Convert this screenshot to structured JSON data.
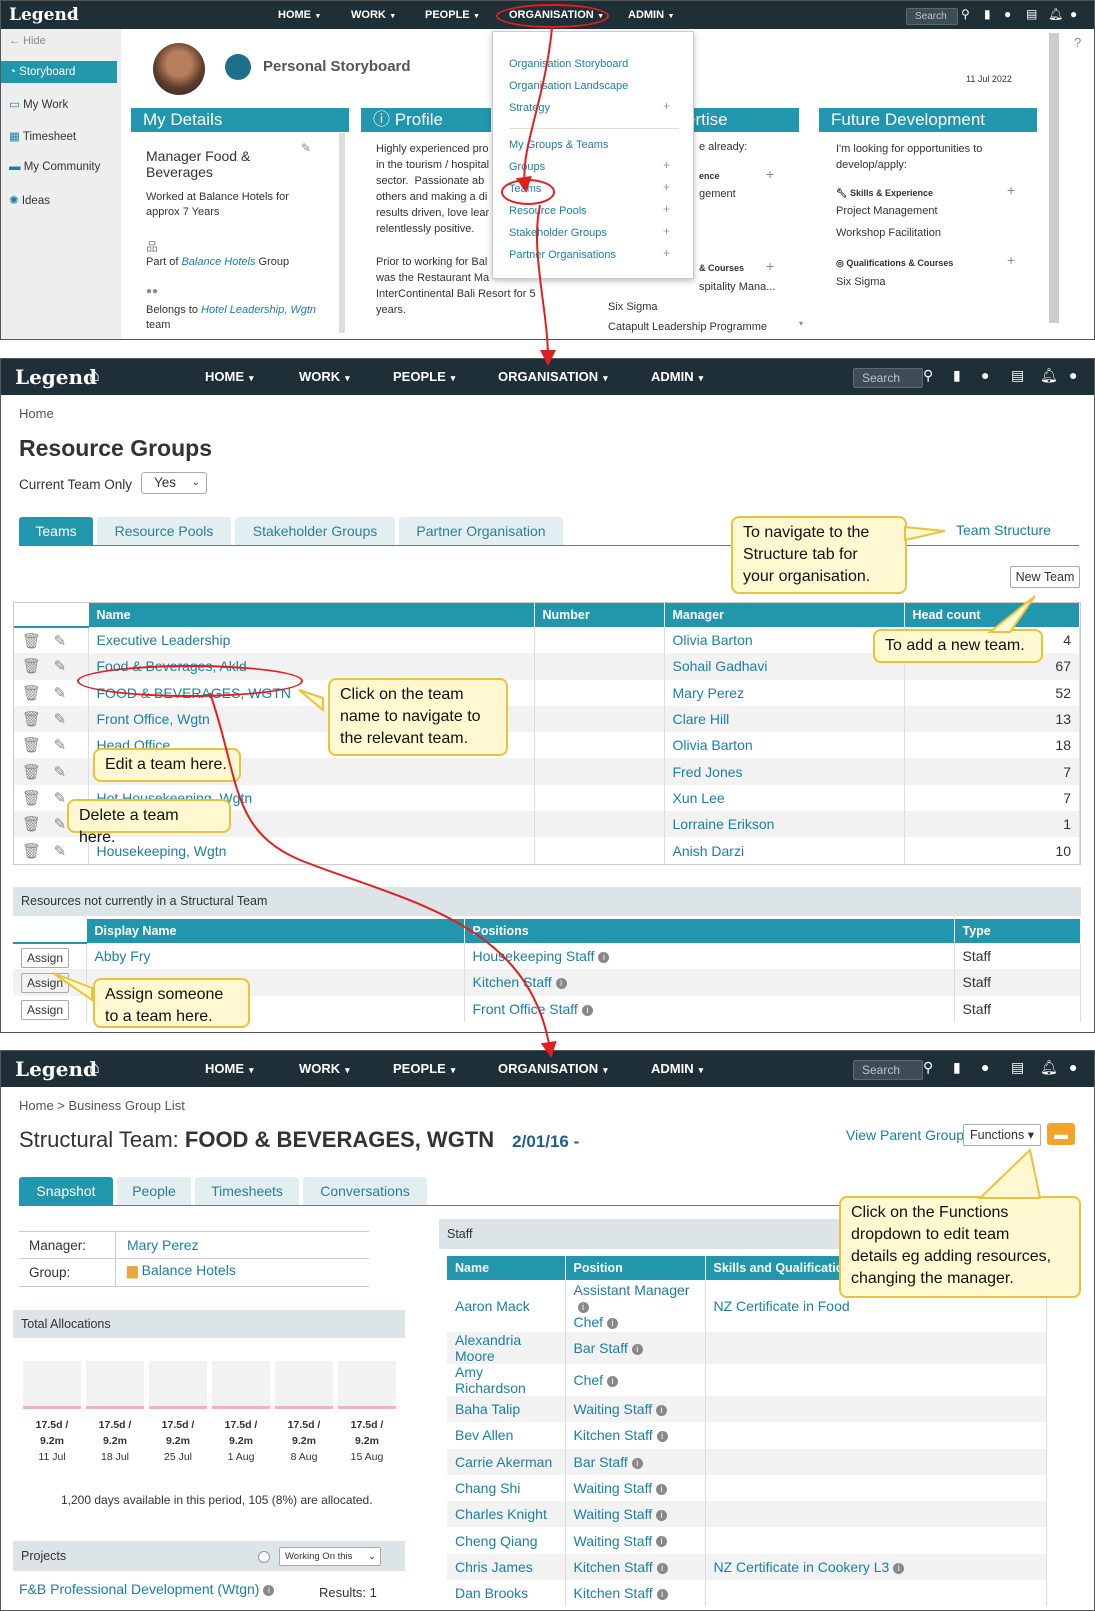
{
  "panel1": {
    "nav": {
      "logo": "Legend",
      "items": [
        "HOME",
        "WORK",
        "PEOPLE",
        "ORGANISATION",
        "ADMIN"
      ],
      "search_placeholder": "Search"
    },
    "sidebar": {
      "hide": "Hide",
      "items": [
        "Storyboard",
        "My Work",
        "Timesheet",
        "My Community",
        "Ideas"
      ]
    },
    "title": "Personal Storyboard",
    "date": "11 Jul 2022",
    "my_details": {
      "header": "My Details",
      "role": "Manager Food & Beverages",
      "worked": "Worked at Balance Hotels for approx 7 Years",
      "part_of_pre": "Part of ",
      "part_of_link": "Balance Hotels",
      "part_of_post": " Group",
      "belongs_pre": "Belongs to ",
      "belongs_link": "Hotel Leadership, Wgtn",
      "belongs_post": " team"
    },
    "profile": {
      "header": "Profile",
      "p1": "Highly experienced pro\nin the tourism / hospital\nsector.  Passionate ab\nothers and making a di\nresults driven, love lear\nrelentlessly positive.",
      "p2": "Prior to working for Bal\nwas the Restaurant Ma\nInterContinental Bali Resort for 5\nyears."
    },
    "expertise": {
      "header": "ertise",
      "l1": "e already:",
      "l2": "ence",
      "l3": "gement",
      "l4": "& Courses",
      "l5": "spitality Mana...",
      "l6": "Six Sigma",
      "l7": "Catapult Leadership Programme"
    },
    "future": {
      "header": "Future Development",
      "intro": "I'm looking for opportunities to develop/apply:",
      "skills_hd": "Skills & Experience",
      "skills": [
        "Project Management",
        "Workshop Facilitation"
      ],
      "quals_hd": "Qualifications & Courses",
      "quals": [
        "Six Sigma"
      ]
    },
    "dropdown": [
      "Organisation Storyboard",
      "Organisation Landscape",
      "Strategy",
      "My Groups & Teams",
      "Groups",
      "Teams",
      "Resource Pools",
      "Stakeholder Groups",
      "Partner Organisations"
    ]
  },
  "panel2": {
    "nav": {
      "logo": "Legend",
      "items": [
        "HOME",
        "WORK",
        "PEOPLE",
        "ORGANISATION",
        "ADMIN"
      ],
      "search_placeholder": "Search"
    },
    "breadcrumb": "Home",
    "title": "Resource Groups",
    "current_team_label": "Current Team Only",
    "current_team_value": "Yes",
    "tabs": [
      "Teams",
      "Resource Pools",
      "Stakeholder Groups",
      "Partner Organisation"
    ],
    "team_structure": "Team Structure",
    "new_team": "New Team",
    "columns": [
      "Name",
      "Number",
      "Manager",
      "Head count"
    ],
    "rows": [
      {
        "name": "Executive Leadership",
        "manager": "Olivia Barton",
        "count": "4"
      },
      {
        "name": "Food & Beverages, Akld",
        "manager": "Sohail Gadhavi",
        "count": "67"
      },
      {
        "name": "FOOD & BEVERAGES, WGTN",
        "manager": "Mary Perez",
        "count": "52"
      },
      {
        "name": "Front Office, Wgtn",
        "manager": "Clare Hill",
        "count": "13"
      },
      {
        "name": "Head Office",
        "manager": "Olivia Barton",
        "count": "18"
      },
      {
        "name": "",
        "manager": "Fred Jones",
        "count": "7"
      },
      {
        "name": "Hot Housekeeping, Wgtn",
        "manager": "Xun Lee",
        "count": "7"
      },
      {
        "name": "",
        "manager": "Lorraine Erikson",
        "count": "1"
      },
      {
        "name": "Housekeeping, Wgtn",
        "manager": "Anish Darzi",
        "count": "10"
      }
    ],
    "unassigned_header": "Resources not currently in a Structural Team",
    "unassigned_columns": [
      "Display Name",
      "Positions",
      "Type"
    ],
    "assign_label": "Assign",
    "unassigned": [
      {
        "name": "Abby Fry",
        "position": "Housekeeping Staff",
        "type": "Staff"
      },
      {
        "name": "",
        "position": "Kitchen Staff",
        "type": "Staff"
      },
      {
        "name": "",
        "position": "Front Office Staff",
        "type": "Staff"
      }
    ],
    "callouts": {
      "structure": "To navigate to the\nStructure tab for\nyour organisation.",
      "new_team": "To add a new team.",
      "click_team": "Click on the team\nname to navigate to\nthe relevant team.",
      "edit": "Edit a team here.",
      "delete": "Delete a team here.",
      "assign": "Assign someone\nto a team here."
    }
  },
  "panel3": {
    "nav": {
      "logo": "Legend",
      "items": [
        "HOME",
        "WORK",
        "PEOPLE",
        "ORGANISATION",
        "ADMIN"
      ],
      "search_placeholder": "Search"
    },
    "breadcrumb": "Home > Business Group List",
    "title_prefix": "Structural Team: ",
    "title_name": "FOOD & BEVERAGES, WGTN",
    "title_date": "2/01/16 -",
    "view_parent": "View Parent Group",
    "functions": "Functions",
    "tabs": [
      "Snapshot",
      "People",
      "Timesheets",
      "Conversations"
    ],
    "manager_label": "Manager:",
    "manager": "Mary Perez",
    "group_label": "Group:",
    "group": "Balance Hotels",
    "total_alloc": "Total Allocations",
    "alloc_bars": [
      {
        "l1": "17.5d /",
        "l2": "9.2m",
        "date": "11 Jul"
      },
      {
        "l1": "17.5d /",
        "l2": "9.2m",
        "date": "18 Jul"
      },
      {
        "l1": "17.5d /",
        "l2": "9.2m",
        "date": "25 Jul"
      },
      {
        "l1": "17.5d /",
        "l2": "9.2m",
        "date": "1 Aug"
      },
      {
        "l1": "17.5d /",
        "l2": "9.2m",
        "date": "8 Aug"
      },
      {
        "l1": "17.5d /",
        "l2": "9.2m",
        "date": "15 Aug"
      }
    ],
    "alloc_summary": "1,200 days available in this period, 105 (8%) are allocated.",
    "projects": "Projects",
    "projects_filter": "Working On this",
    "project_item": "F&B Professional Development (Wtgn)",
    "results": "Results: 1",
    "staff_header": "Staff",
    "staff_columns": [
      "Name",
      "Position",
      "Skills and Qualificatio"
    ],
    "staff": [
      {
        "name": "Aaron Mack",
        "position": "Assistant Manager",
        "position2": "Chef",
        "skill": "NZ Certificate in Food"
      },
      {
        "name": "Alexandria Moore",
        "position": "Bar Staff",
        "skill": ""
      },
      {
        "name": "Amy Richardson",
        "position": "Chef",
        "skill": ""
      },
      {
        "name": "Baha Talip",
        "position": "Waiting Staff",
        "skill": ""
      },
      {
        "name": "Bev Allen",
        "position": "Kitchen Staff",
        "skill": ""
      },
      {
        "name": "Carrie Akerman",
        "position": "Bar Staff",
        "skill": ""
      },
      {
        "name": "Chang Shi",
        "position": "Waiting Staff",
        "skill": ""
      },
      {
        "name": "Charles Knight",
        "position": "Waiting Staff",
        "skill": ""
      },
      {
        "name": "Cheng Qiang",
        "position": "Waiting Staff",
        "skill": ""
      },
      {
        "name": "Chris James",
        "position": "Kitchen Staff",
        "skill": "NZ Certificate in Cookery L3"
      },
      {
        "name": "Dan Brooks",
        "position": "Kitchen Staff",
        "skill": ""
      }
    ],
    "callout": "Click on the Functions\ndropdown to edit team\ndetails eg adding resources,\nchanging the manager."
  }
}
